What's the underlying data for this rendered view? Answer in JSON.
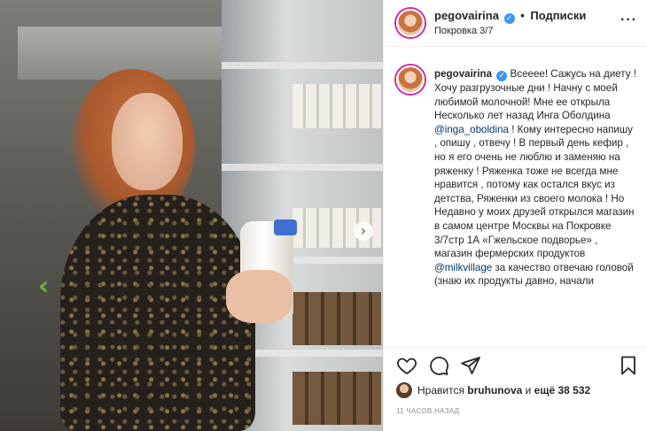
{
  "header": {
    "username": "pegovairina",
    "follow_label": "Подписки",
    "location": "Покровка 3/7",
    "more_label": "···"
  },
  "caption": {
    "username": "pegovairina",
    "text_1": "Всееее! Сажусь на диету ! Хочу разгрузочные дни ! Начну с моей любимой молочной! Мне ее открыла Несколько лет назад Инга Оболдина ",
    "mention_1": "@inga_oboldina",
    "text_2": " ! Кому интересно напишу , опишу , отвечу ! В первый день кефир , но я его очень не люблю и заменяю на ряженку ! Ряженка тоже не всегда мне нравится , потому как остался вкус из детства, Ряженки из своего молока ! Но Недавно у моих друзей открылся магазин в самом центре Москвы на Покровке 3/7стр 1А «Гжельское подворье» , магазин фермерских продуктов ",
    "mention_2": "@milkvillage",
    "text_3": " за качество отвечаю головой (знаю их продукты давно, начали"
  },
  "photo": {
    "next_label": "›",
    "side_arrow": "‹"
  },
  "likes": {
    "prefix": "Нравится ",
    "user": "bruhunova",
    "middle": " и ",
    "count": "ещё 38 532"
  },
  "timestamp": "11 ЧАСОВ НАЗАД",
  "colors": {
    "verified": "#3897f0",
    "mention": "#00376b",
    "story_ring": "#d6249f"
  }
}
